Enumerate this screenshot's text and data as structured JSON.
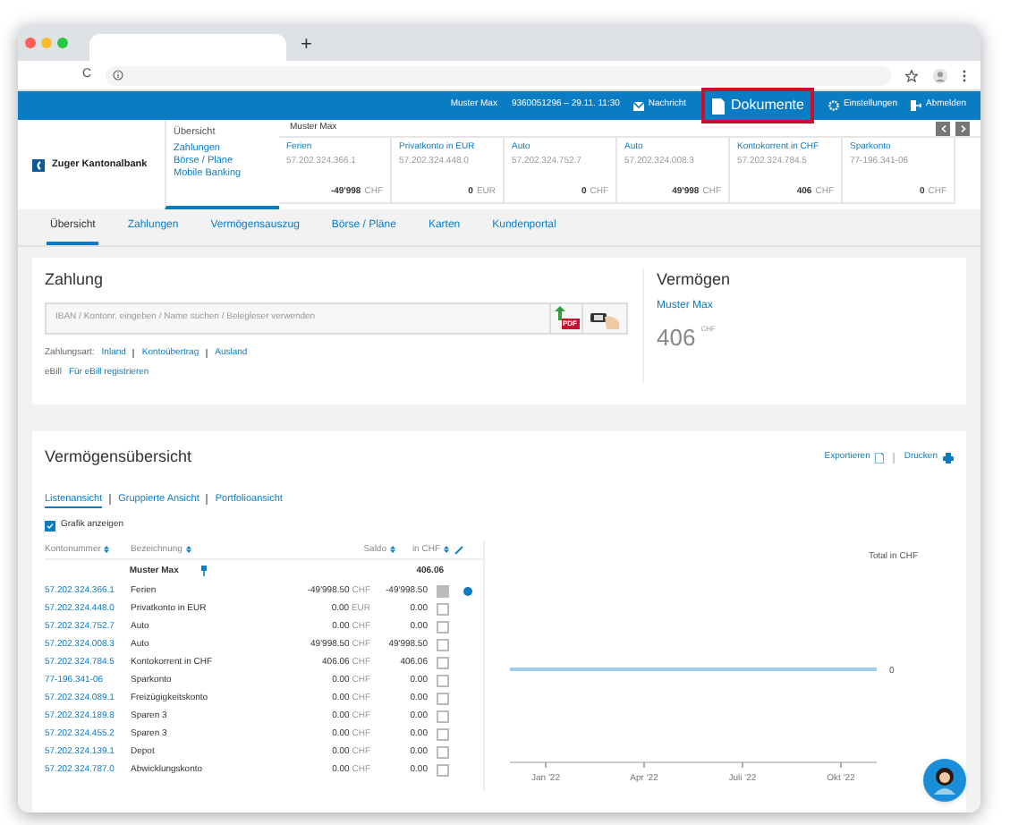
{
  "browser": {
    "new_tab": "+",
    "reload": "C"
  },
  "header": {
    "user": "Muster Max",
    "session": "9360051296 – 29.11. 11:30",
    "links": [
      {
        "label": "Nachricht",
        "kind": "mail",
        "highlighted": false
      },
      {
        "label": "Dokumente",
        "kind": "doc",
        "highlighted": true
      },
      {
        "label": "Einstellungen",
        "kind": "gear",
        "highlighted": false
      },
      {
        "label": "Abmelden",
        "kind": "exit",
        "highlighted": false
      }
    ]
  },
  "logo": "Zuger Kantonalbank",
  "side_menu": [
    {
      "label": "Übersicht",
      "selected": true
    },
    {
      "label": "Zahlungen",
      "selected": false
    },
    {
      "label": "Börse / Pläne",
      "selected": false
    },
    {
      "label": "Mobile Banking",
      "selected": false
    }
  ],
  "accounts_owner": "Muster Max",
  "account_cards": [
    {
      "name": "Ferien",
      "number": "57.202.324.366.1",
      "amount": "-49'998",
      "currency": "CHF"
    },
    {
      "name": "Privatkonto in EUR",
      "number": "57.202.324.448.0",
      "amount": "0",
      "currency": "EUR"
    },
    {
      "name": "Auto",
      "number": "57.202.324.752.7",
      "amount": "0",
      "currency": "CHF"
    },
    {
      "name": "Auto",
      "number": "57.202.324.008.3",
      "amount": "49'998",
      "currency": "CHF"
    },
    {
      "name": "Kontokorrent in CHF",
      "number": "57.202.324.784.5",
      "amount": "406",
      "currency": "CHF"
    },
    {
      "name": "Sparkonto",
      "number": "77-196.341-06",
      "amount": "0",
      "currency": "CHF"
    }
  ],
  "tabs": [
    {
      "label": "Übersicht",
      "selected": true
    },
    {
      "label": "Zahlungen",
      "selected": false
    },
    {
      "label": "Vermögensauszug",
      "selected": false
    },
    {
      "label": "Börse / Pläne",
      "selected": false
    },
    {
      "label": "Karten",
      "selected": false
    },
    {
      "label": "Kundenportal",
      "selected": false
    }
  ],
  "payment": {
    "title": "Zahlung",
    "placeholder": "IBAN / Kontonr. eingeben / Name suchen / Belegleser verwenden",
    "pdf_label": "PDF",
    "type_label": "Zahlungsart:",
    "types": [
      "Inland",
      "Kontoübertrag",
      "Ausland"
    ],
    "ebill_label": "eBill",
    "ebill_link": "Für eBill registrieren"
  },
  "assets": {
    "title": "Vermögen",
    "owner": "Muster Max",
    "value": "406",
    "currency": "CHF"
  },
  "overview": {
    "title": "Vermögensübersicht",
    "export": "Exportieren",
    "print": "Drucken",
    "views": [
      {
        "label": "Listenansicht",
        "selected": true
      },
      {
        "label": "Gruppierte Ansicht",
        "selected": false
      },
      {
        "label": "Portfolioansicht",
        "selected": false
      }
    ],
    "show_chart": {
      "label": "Grafik anzeigen",
      "checked": true
    },
    "columns": [
      "Kontonummer",
      "Bezeichnung",
      "Saldo",
      "in CHF"
    ],
    "group": {
      "name": "Muster Max",
      "total": "406.06"
    },
    "rows": [
      {
        "number": "57.202.324.366.1",
        "name": "Ferien",
        "saldo": "-49'998.50",
        "currency": "CHF",
        "chf": "-49'998.50",
        "checked": true,
        "dot": true
      },
      {
        "number": "57.202.324.448.0",
        "name": "Privatkonto in EUR",
        "saldo": "0.00",
        "currency": "EUR",
        "chf": "0.00",
        "checked": false,
        "dot": false
      },
      {
        "number": "57.202.324.752.7",
        "name": "Auto",
        "saldo": "0.00",
        "currency": "CHF",
        "chf": "0.00",
        "checked": false,
        "dot": false
      },
      {
        "number": "57.202.324.008.3",
        "name": "Auto",
        "saldo": "49'998.50",
        "currency": "CHF",
        "chf": "49'998.50",
        "checked": false,
        "dot": false
      },
      {
        "number": "57.202.324.784.5",
        "name": "Kontokorrent in CHF",
        "saldo": "406.06",
        "currency": "CHF",
        "chf": "406.06",
        "checked": false,
        "dot": false
      },
      {
        "number": "77-196.341-06",
        "name": "Sparkonto",
        "saldo": "0.00",
        "currency": "CHF",
        "chf": "0.00",
        "checked": false,
        "dot": false
      },
      {
        "number": "57.202.324.089.1",
        "name": "Freizügigkeitskonto",
        "saldo": "0.00",
        "currency": "CHF",
        "chf": "0.00",
        "checked": false,
        "dot": false
      },
      {
        "number": "57.202.324.189.8",
        "name": "Sparen 3",
        "saldo": "0.00",
        "currency": "CHF",
        "chf": "0.00",
        "checked": false,
        "dot": false
      },
      {
        "number": "57.202.324.455.2",
        "name": "Sparen 3",
        "saldo": "0.00",
        "currency": "CHF",
        "chf": "0.00",
        "checked": false,
        "dot": false
      },
      {
        "number": "57.202.324.139.1",
        "name": "Depot",
        "saldo": "0.00",
        "currency": "CHF",
        "chf": "0.00",
        "checked": false,
        "dot": false
      },
      {
        "number": "57.202.324.787.0",
        "name": "Abwicklungskonto",
        "saldo": "0.00",
        "currency": "CHF",
        "chf": "0.00",
        "checked": false,
        "dot": false
      }
    ],
    "chart": {
      "y_label": "Total in CHF",
      "line_label": "0",
      "x_labels": [
        "Jan '22",
        "Apr '22",
        "Juli '22",
        "Okt '22"
      ]
    }
  }
}
